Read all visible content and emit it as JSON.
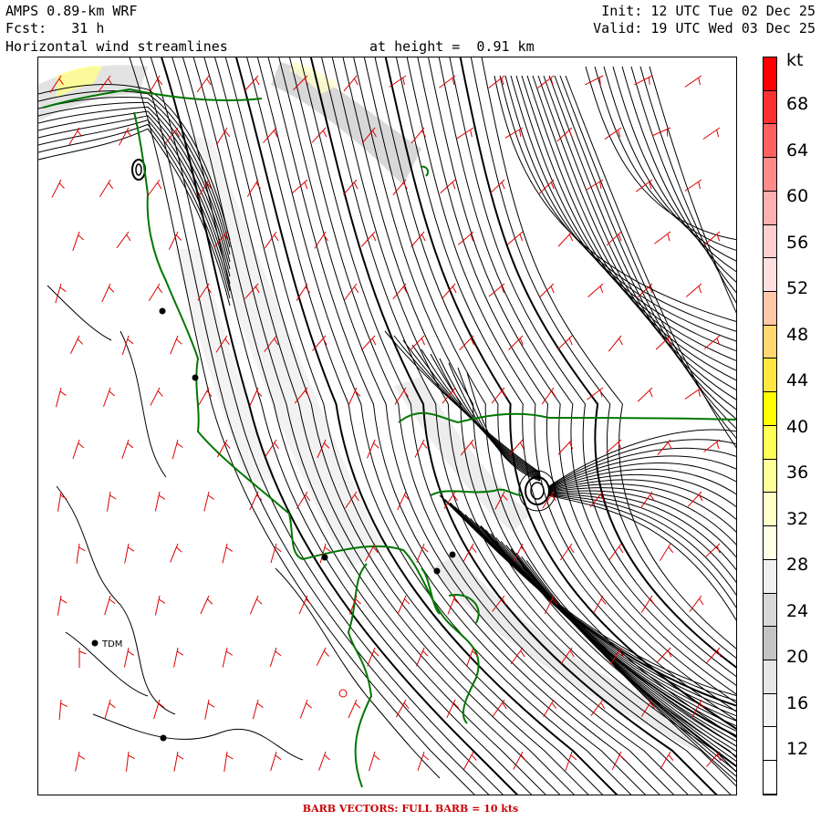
{
  "header": {
    "model": "AMPS 0.89-km WRF",
    "forecast": "Fcst:   31 h",
    "field": "Horizontal wind streamlines",
    "height": "at height =  0.91 km",
    "init": "Init: 12 UTC Tue 02 Dec 25",
    "valid": "Valid: 19 UTC Wed 03 Dec 25"
  },
  "footer": {
    "barb_note": "BARB VECTORS:  FULL BARB = 10 kts"
  },
  "colorbar": {
    "unit": "kt",
    "labels": [
      "68",
      "64",
      "60",
      "56",
      "52",
      "48",
      "44",
      "40",
      "36",
      "32",
      "28",
      "24",
      "20",
      "16",
      "12"
    ],
    "colors": [
      "#ff0000",
      "#ff3030",
      "#ff6060",
      "#ff8a8a",
      "#ffb0b0",
      "#ffcfcf",
      "#ffe0e0",
      "#ffc8a8",
      "#ffd870",
      "#ffe640",
      "#ffff00",
      "#ffff55",
      "#ffff99",
      "#ffffc8",
      "#ffffe6",
      "#f0f0f0",
      "#d8d8d8",
      "#c4c4c4",
      "#e6e6e6",
      "#f4f4f4",
      "#ffffff",
      "#ffffff"
    ]
  },
  "map": {
    "station_label": "TDM",
    "coast_color": "#007700",
    "barb_color": "#dd0000",
    "streamline_color": "#000000"
  }
}
